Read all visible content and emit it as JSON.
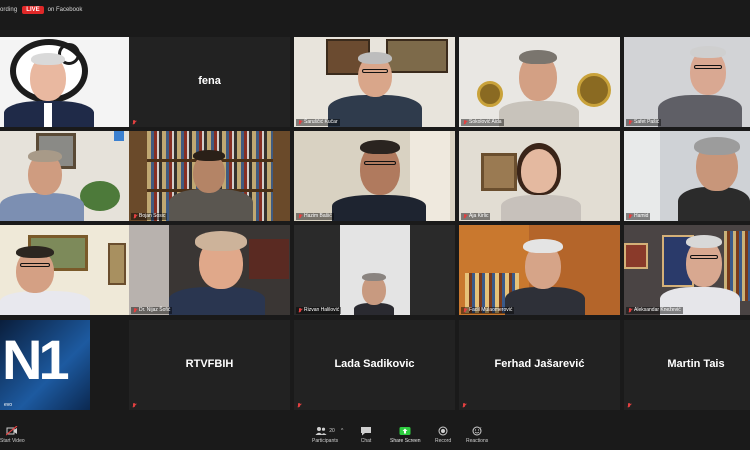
{
  "top_bar": {
    "recording_text": "ording",
    "live_badge": "LIVE",
    "platform_text": "on Facebook"
  },
  "participants": [
    {
      "id": "p1",
      "name": ""
    },
    {
      "id": "p2",
      "name": "fena"
    },
    {
      "id": "p3",
      "name": "Šaruščić Kučar"
    },
    {
      "id": "p4",
      "name": "Sokolović Aida"
    },
    {
      "id": "p5",
      "name": "Safet Pašić"
    },
    {
      "id": "p6",
      "name": ""
    },
    {
      "id": "p7",
      "name": "Bojan Sosic"
    },
    {
      "id": "p8",
      "name": "Hazim Bašić"
    },
    {
      "id": "p9",
      "name": "Aja Kirlic"
    },
    {
      "id": "p10",
      "name": "Hamid"
    },
    {
      "id": "p11",
      "name": ""
    },
    {
      "id": "p12",
      "name": "Dr. Nijaz Šofić"
    },
    {
      "id": "p13",
      "name": "Rizvan Halilović"
    },
    {
      "id": "p14",
      "name": "Fadil Mulaomerović"
    },
    {
      "id": "p15",
      "name": "Aleksandar Knežević"
    },
    {
      "id": "p16",
      "name": "evo",
      "logo_text": "N1"
    },
    {
      "id": "p17",
      "name": "RTVFBIH"
    },
    {
      "id": "p18",
      "name": "Lada Sadikovic"
    },
    {
      "id": "p19",
      "name": "Ferhad Jašarević"
    },
    {
      "id": "p20",
      "name": "Martin Tais"
    }
  ],
  "toolbar": {
    "start_video_label": "Start Video",
    "participants_label": "Participants",
    "participants_count": "20",
    "chat_label": "Chat",
    "share_screen_label": "Share Screen",
    "record_label": "Record",
    "reactions_label": "Reactions"
  },
  "colors": {
    "background": "#1a1a1a",
    "tile_bg": "#242424",
    "live_red": "#e02828",
    "mute_red": "#e24040",
    "share_green": "#2ecc40"
  }
}
